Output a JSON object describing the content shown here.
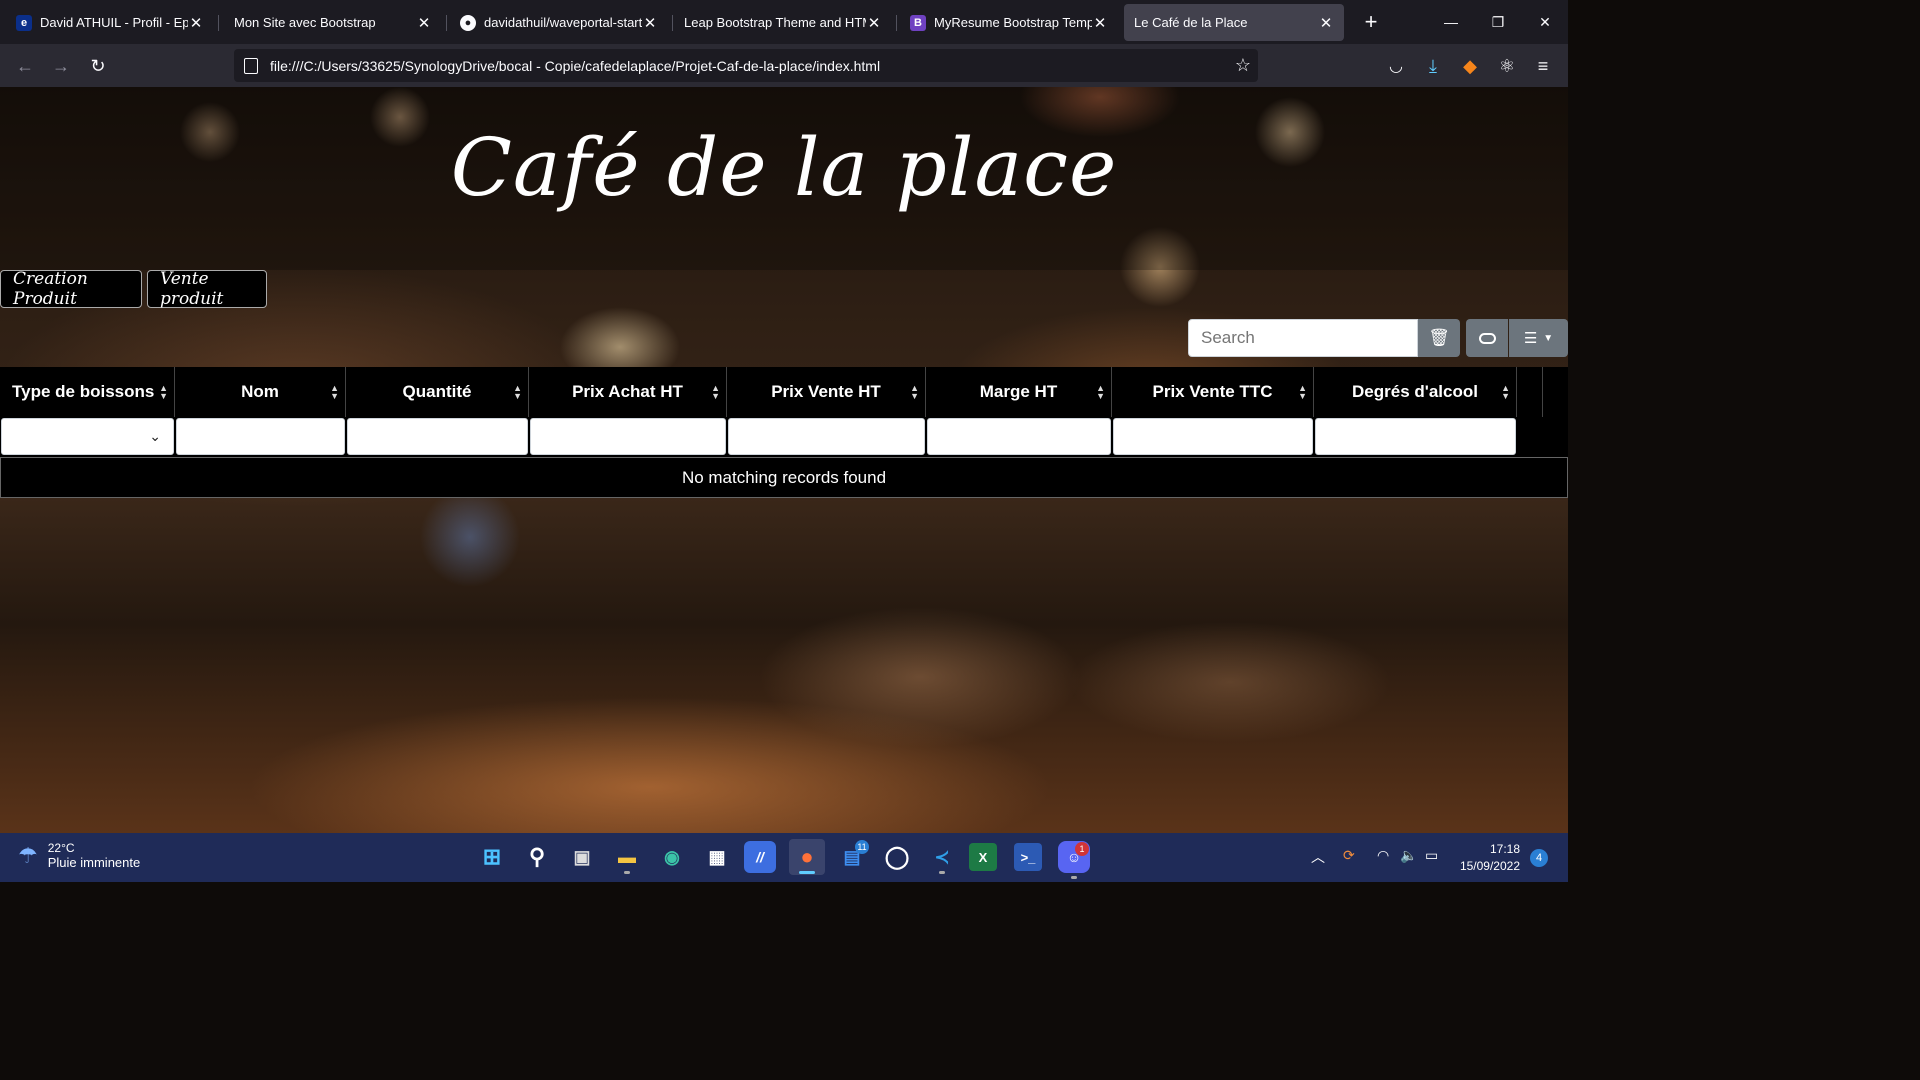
{
  "browser": {
    "tabs": [
      {
        "title": "David ATHUIL - Profil - Epitech",
        "icon": "epitech-icon"
      },
      {
        "title": "Mon Site avec Bootstrap",
        "icon": "blank-icon"
      },
      {
        "title": "davidathuil/waveportal-starter",
        "icon": "github-icon"
      },
      {
        "title": "Leap Bootstrap Theme and HTML T",
        "icon": "blank-icon"
      },
      {
        "title": "MyResume Bootstrap Template",
        "icon": "bootstrap-icon"
      },
      {
        "title": "Le Café de la Place",
        "icon": "blank-icon"
      }
    ],
    "active_tab": 5,
    "url": "file:///C:/Users/33625/SynologyDrive/bocal - Copie/cafedelaplace/Projet-Caf-de-la-place/index.html",
    "new_tab_label": "+",
    "window_controls": {
      "minimize": "—",
      "restore": "❐",
      "close": "✕"
    }
  },
  "page": {
    "title": "Café de la place",
    "buttons": {
      "creation": "Creation Produit",
      "vente": "Vente produit"
    },
    "search": {
      "placeholder": "Search"
    },
    "table": {
      "columns": [
        "Type de boissons",
        "Nom",
        "Quantité",
        "Prix Achat HT",
        "Prix Vente HT",
        "Marge HT",
        "Prix Vente TTC",
        "Degrés d'alcool"
      ],
      "empty_message": "No matching records found"
    }
  },
  "taskbar": {
    "weather": {
      "temp": "22°C",
      "desc": "Pluie imminente"
    },
    "apps": [
      "windows-start",
      "search",
      "task-view",
      "file-explorer",
      "edge",
      "microsoft-store",
      "visual-studio",
      "firefox",
      "mail",
      "whatsapp",
      "vscode",
      "excel",
      "powershell",
      "discord"
    ],
    "badges": {
      "mail": "11",
      "discord": "1"
    },
    "clock": {
      "time": "17:18",
      "date": "15/09/2022"
    },
    "notifications": "4"
  },
  "colors": {
    "tab_active": "#42414d",
    "tabbar_bg": "#1c1b22",
    "navbar_bg": "#2b2a33",
    "taskbar_bg": "#1f2b58",
    "table_header_bg": "#000000",
    "tool_button_bg": "#6c757d"
  }
}
